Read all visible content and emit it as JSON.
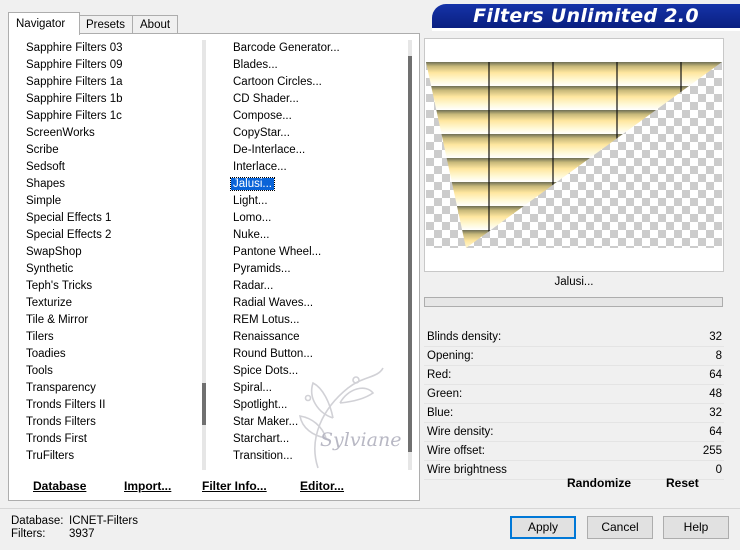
{
  "app_title": "Filters Unlimited 2.0",
  "tabs": [
    {
      "label": "Navigator",
      "active": true
    },
    {
      "label": "Presets",
      "active": false
    },
    {
      "label": "About",
      "active": false
    }
  ],
  "categories": [
    "Sapphire Filters 03",
    "Sapphire Filters 09",
    "Sapphire Filters 1a",
    "Sapphire Filters 1b",
    "Sapphire Filters 1c",
    "ScreenWorks",
    "Scribe",
    "Sedsoft",
    "Shapes",
    "Simple",
    "Special Effects 1",
    "Special Effects 2",
    "SwapShop",
    "Synthetic",
    "Teph's Tricks",
    "Texturize",
    "Tile & Mirror",
    "Tilers",
    "Toadies",
    "Tools",
    "Transparency",
    "Tronds Filters II",
    "Tronds Filters",
    "Tronds First",
    "TruFilters"
  ],
  "filters": [
    "Barcode Generator...",
    "Blades...",
    "Cartoon Circles...",
    "CD Shader...",
    "Compose...",
    "CopyStar...",
    "De-Interlace...",
    "Interlace...",
    "Jalusi...",
    "Light...",
    "Lomo...",
    "Nuke...",
    "Pantone Wheel...",
    "Pyramids...",
    "Radar...",
    "Radial Waves...",
    "REM Lotus...",
    "Renaissance",
    "Round Button...",
    "Spice Dots...",
    "Spiral...",
    "Spotlight...",
    "Star Maker...",
    "Starchart...",
    "Transition..."
  ],
  "selected_filter_index": 8,
  "bottom_buttons": {
    "database": "Database",
    "import": "Import...",
    "filter_info": "Filter Info...",
    "editor": "Editor..."
  },
  "filter_name": "Jalusi...",
  "params": [
    {
      "label": "Blinds density:",
      "value": "32"
    },
    {
      "label": "Opening:",
      "value": "8"
    },
    {
      "label": "Red:",
      "value": "64"
    },
    {
      "label": "Green:",
      "value": "48"
    },
    {
      "label": "Blue:",
      "value": "32"
    },
    {
      "label": "Wire density:",
      "value": "64"
    },
    {
      "label": "Wire offset:",
      "value": "255"
    },
    {
      "label": "Wire brightness",
      "value": "0"
    }
  ],
  "randomize_label": "Randomize",
  "reset_label": "Reset",
  "footer": {
    "database_label": "Database:",
    "database_value": "ICNET-Filters",
    "filters_label": "Filters:",
    "filters_value": "3937"
  },
  "buttons": {
    "apply": "Apply",
    "cancel": "Cancel",
    "help": "Help"
  },
  "watermark_text": "Sylviane",
  "colors": {
    "title_bar": "#0a1f80",
    "selection": "#0a64d8",
    "blind_light": "#fff2b0",
    "blind_dark": "#6e6e55"
  }
}
